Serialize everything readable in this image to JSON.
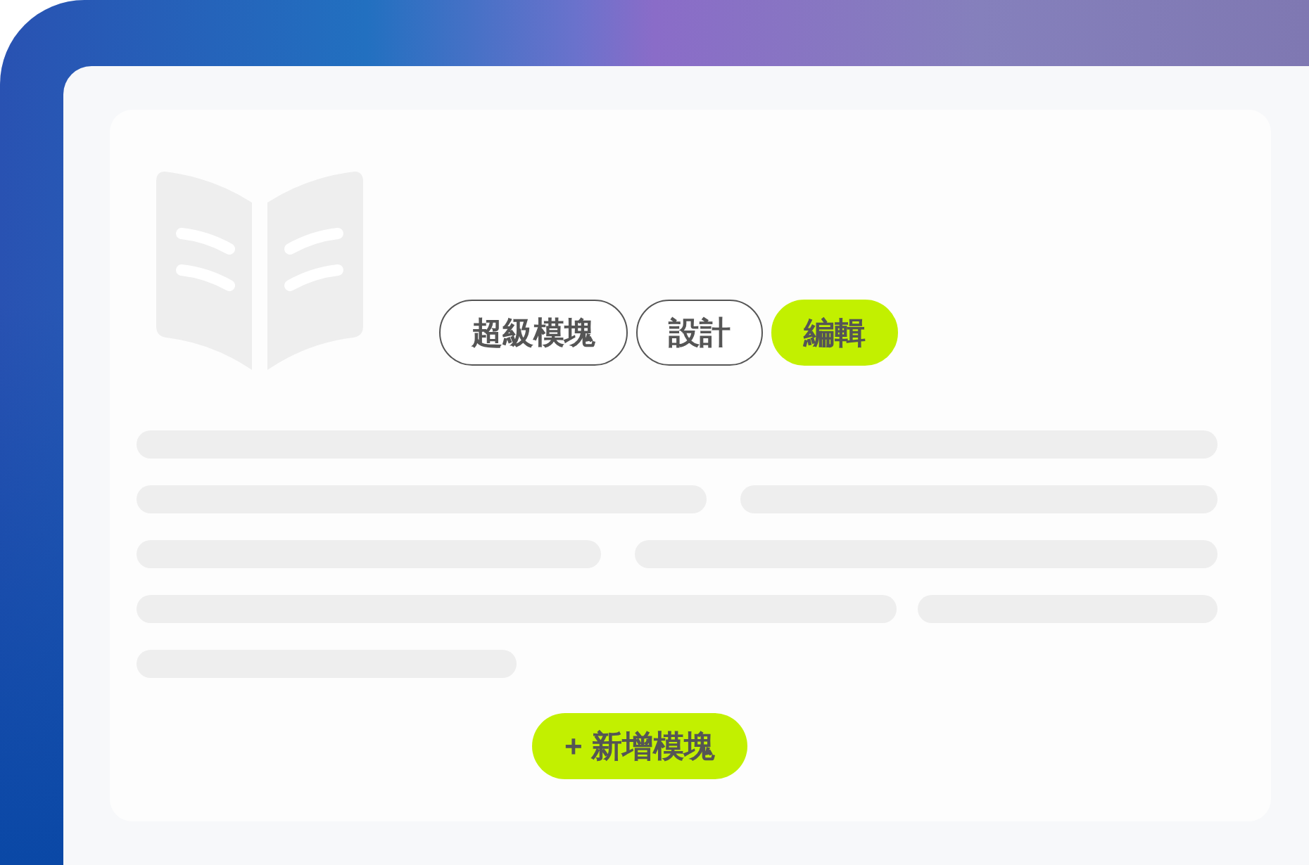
{
  "tags": [
    {
      "label": "超級模塊",
      "selected": false
    },
    {
      "label": "設計",
      "selected": false
    },
    {
      "label": "編輯",
      "selected": true
    }
  ],
  "add_button": {
    "label": "+ 新增模塊"
  }
}
